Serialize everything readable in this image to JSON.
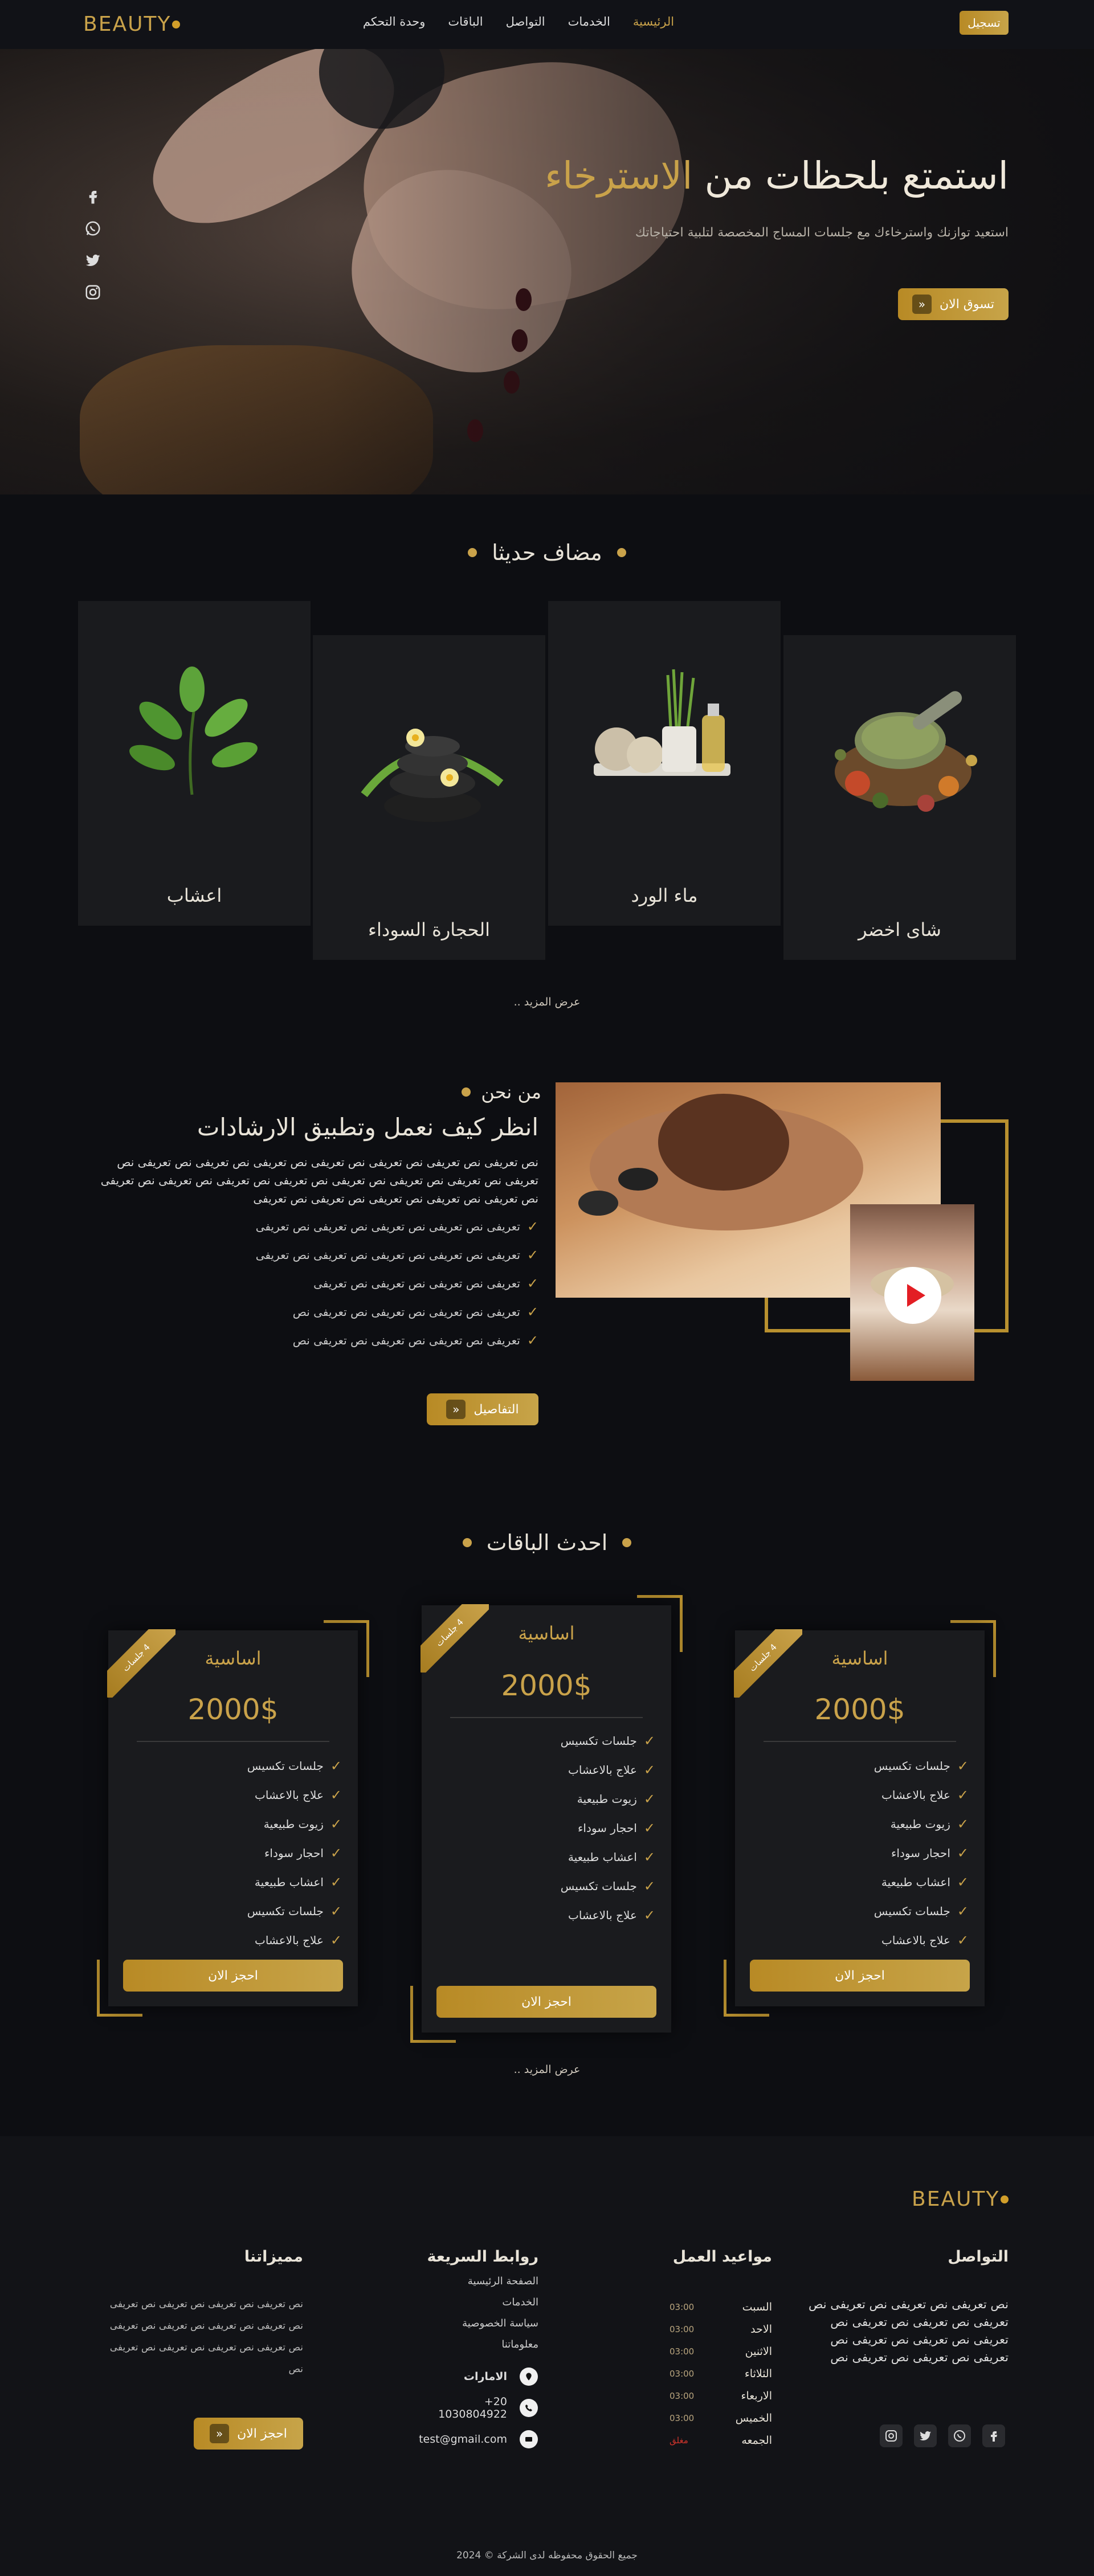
{
  "nav": {
    "logo": "BEAUTY",
    "links": [
      {
        "label": "الرئيسية"
      },
      {
        "label": "الخدمات"
      },
      {
        "label": "التواصل"
      },
      {
        "label": "الباقات"
      },
      {
        "label": "وحدة التحكم"
      }
    ],
    "register_label": "تسجيل"
  },
  "hero": {
    "title_part1": "استمتع بلحظات من ",
    "title_highlight": "الاسترخاء",
    "subtitle": "استعيد توازنك واسترخاءك مع جلسات المساج المخصصة لتلبية احتياجاتك",
    "cta_label": "تسوق الان",
    "social": [
      "facebook-icon",
      "whatsapp-icon",
      "twitter-icon",
      "instagram-icon"
    ]
  },
  "recent": {
    "title": "مضاف حديثا",
    "products": [
      {
        "label": "شاى اخضر"
      },
      {
        "label": "ماء الورد"
      },
      {
        "label": "الحجارة السوداء"
      },
      {
        "label": "اعشاب"
      }
    ],
    "more_label": "عرض المزيد .."
  },
  "about": {
    "eyebrow": "من نحن",
    "title": "انظر كيف نعمل وتطبيق الارشادات",
    "text": "نص تعريفى نص تعريفى نص تعريفى نص تعريفى نص تعريفى نص تعريفى نص تعريفى نص تعريفى نص تعريفى نص تعريفى نص تعريفى نص تعريفى نص تعريفى نص تعريفى نص تعريفى نص تعريفى نص تعريفى نص تعريفى نص تعريفى نص تعريفى",
    "list": [
      "تعريفى نص تعريفى نص تعريفى نص تعريفى نص تعريفى",
      "تعريفى نص تعريفى نص تعريفى نص تعريفى نص تعريفى",
      "تعريفى نص تعريفى نص تعريفى نص تعريفى",
      "تعريفى نص تعريفى نص تعريفى نص تعريفى نص",
      "تعريفى نص تعريفى نص تعريفى نص تعريفى نص"
    ],
    "details_label": "التفاصيل"
  },
  "packages": {
    "title": "احدث الباقات",
    "cards": [
      {
        "ribbon": "4 جلسات",
        "name": "اساسية",
        "price": "2000$",
        "features": [
          "جلسات تكسيس",
          "علاج بالاعشاب",
          "زيوت طبيعية",
          "احجار سوداء",
          "اعشاب طبيعية",
          "جلسات تكسيس",
          "علاج بالاعشاب"
        ],
        "cta": "احجز الان"
      },
      {
        "ribbon": "4 جلسات",
        "name": "اساسية",
        "price": "2000$",
        "features": [
          "جلسات تكسيس",
          "علاج بالاعشاب",
          "زيوت طبيعية",
          "احجار سوداء",
          "اعشاب طبيعية",
          "جلسات تكسيس",
          "علاج بالاعشاب"
        ],
        "cta": "احجز الان"
      },
      {
        "ribbon": "4 جلسات",
        "name": "اساسية",
        "price": "2000$",
        "features": [
          "جلسات تكسيس",
          "علاج بالاعشاب",
          "زيوت طبيعية",
          "احجار سوداء",
          "اعشاب طبيعية",
          "جلسات تكسيس",
          "علاج بالاعشاب"
        ],
        "cta": "احجز الان"
      }
    ],
    "more_label": "عرض المزيد .."
  },
  "footer": {
    "logo": "BEAUTY",
    "contact": {
      "title": "التواصل",
      "text": "نص تعريفى نص تعريفى نص تعريفى نص تعريفى نص تعريفى نص تعريفى نص تعريفى نص تعريفى نص تعريفى نص تعريفى نص تعريفى نص تعريفى نص",
      "social": [
        "facebook-icon",
        "whatsapp-icon",
        "twitter-icon",
        "instagram-icon"
      ]
    },
    "hours": {
      "title": "مواعيد العمل",
      "rows": [
        {
          "day": "السبت",
          "time": "03:00"
        },
        {
          "day": "الاحد",
          "time": "03:00"
        },
        {
          "day": "الاثنين",
          "time": "03:00"
        },
        {
          "day": "الثلاثاء",
          "time": "03:00"
        },
        {
          "day": "الاربعاء",
          "time": "03:00"
        },
        {
          "day": "الخميس",
          "time": "03:00"
        },
        {
          "day": "الجمعه",
          "time": "مغلق"
        }
      ]
    },
    "links": {
      "title": "روابط السريعة",
      "items": [
        "الصفحة الرئيسية",
        "الخدمات",
        "سياسة الخصوصية",
        "معلوماتنا"
      ],
      "emirates_label": "الامارات",
      "phone": "+20 1030804922",
      "email": "test@gmail.com"
    },
    "features": {
      "title": "مميزاتنا",
      "text": "نص تعريفى نص تعريفى نص تعريفى نص تعريفى نص تعريفى نص تعريفى نص تعريفى نص تعريفى نص تعريفى نص تعريفى نص تعريفى نص تعريفى نص",
      "cta": "احجز الان"
    },
    "copyright": "جميع الحقوق محفوظه لدى الشركة © 2024"
  },
  "colors": {
    "accent": "#c9a24a",
    "background": "#0d0e12",
    "card": "#1a1b1e",
    "closed": "#d0342c"
  }
}
